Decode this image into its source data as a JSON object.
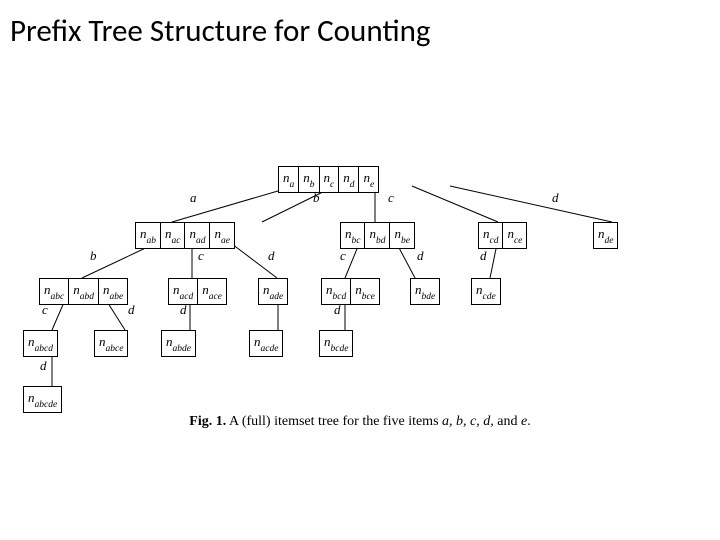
{
  "title": "Prefix Tree Structure for Counting",
  "caption_prefix": "Fig. 1.",
  "caption_body": " A (full) itemset tree for the five items ",
  "caption_items": "a, b, c, d,",
  "caption_and": " and ",
  "caption_last": "e",
  "caption_end": ".",
  "nodes": {
    "na": "a",
    "nb": "b",
    "nc": "c",
    "nd": "d",
    "ne": "e",
    "nab": "ab",
    "nac": "ac",
    "nad": "ad",
    "nae": "ae",
    "nbc": "bc",
    "nbd": "bd",
    "nbe": "be",
    "ncd": "cd",
    "nce": "ce",
    "nde": "de",
    "nabc": "abc",
    "nabd": "abd",
    "nabe": "abe",
    "nacd": "acd",
    "nace": "ace",
    "nade": "ade",
    "nbcd": "bcd",
    "nbce": "bce",
    "nbde": "bde",
    "ncde": "cde",
    "nabcd": "abcd",
    "nabce": "abce",
    "nabde": "abde",
    "nacde": "acde",
    "nbcde": "bcde",
    "nabcde": "abcde"
  },
  "edges": {
    "ea": "a",
    "eb": "b",
    "ec": "c",
    "ed": "d",
    "eab": "b",
    "eac": "c",
    "ead": "d",
    "ebc": "c",
    "ebd": "d",
    "ecd": "d",
    "eabc": "c",
    "eabd": "d",
    "eacd": "d",
    "ebcd": "d",
    "eabcd": "d"
  }
}
